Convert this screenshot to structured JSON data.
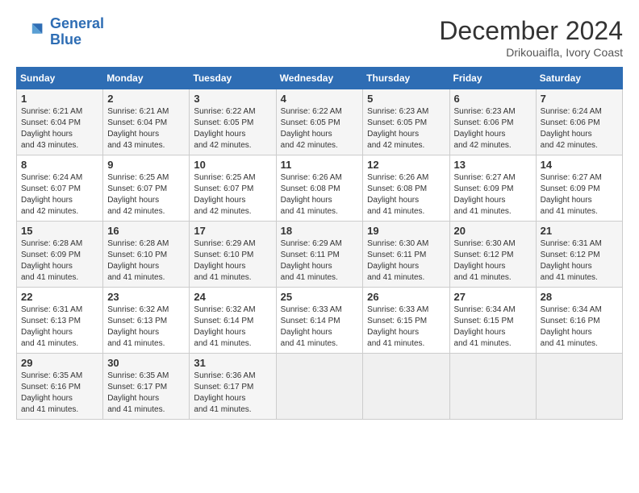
{
  "header": {
    "logo_line1": "General",
    "logo_line2": "Blue",
    "month_year": "December 2024",
    "location": "Drikouaifla, Ivory Coast"
  },
  "days_of_week": [
    "Sunday",
    "Monday",
    "Tuesday",
    "Wednesday",
    "Thursday",
    "Friday",
    "Saturday"
  ],
  "weeks": [
    [
      {
        "day": "1",
        "sunrise": "6:21 AM",
        "sunset": "6:04 PM",
        "daylight": "11 hours and 43 minutes."
      },
      {
        "day": "2",
        "sunrise": "6:21 AM",
        "sunset": "6:04 PM",
        "daylight": "11 hours and 43 minutes."
      },
      {
        "day": "3",
        "sunrise": "6:22 AM",
        "sunset": "6:05 PM",
        "daylight": "11 hours and 42 minutes."
      },
      {
        "day": "4",
        "sunrise": "6:22 AM",
        "sunset": "6:05 PM",
        "daylight": "11 hours and 42 minutes."
      },
      {
        "day": "5",
        "sunrise": "6:23 AM",
        "sunset": "6:05 PM",
        "daylight": "11 hours and 42 minutes."
      },
      {
        "day": "6",
        "sunrise": "6:23 AM",
        "sunset": "6:06 PM",
        "daylight": "11 hours and 42 minutes."
      },
      {
        "day": "7",
        "sunrise": "6:24 AM",
        "sunset": "6:06 PM",
        "daylight": "11 hours and 42 minutes."
      }
    ],
    [
      {
        "day": "8",
        "sunrise": "6:24 AM",
        "sunset": "6:07 PM",
        "daylight": "11 hours and 42 minutes."
      },
      {
        "day": "9",
        "sunrise": "6:25 AM",
        "sunset": "6:07 PM",
        "daylight": "11 hours and 42 minutes."
      },
      {
        "day": "10",
        "sunrise": "6:25 AM",
        "sunset": "6:07 PM",
        "daylight": "11 hours and 42 minutes."
      },
      {
        "day": "11",
        "sunrise": "6:26 AM",
        "sunset": "6:08 PM",
        "daylight": "11 hours and 41 minutes."
      },
      {
        "day": "12",
        "sunrise": "6:26 AM",
        "sunset": "6:08 PM",
        "daylight": "11 hours and 41 minutes."
      },
      {
        "day": "13",
        "sunrise": "6:27 AM",
        "sunset": "6:09 PM",
        "daylight": "11 hours and 41 minutes."
      },
      {
        "day": "14",
        "sunrise": "6:27 AM",
        "sunset": "6:09 PM",
        "daylight": "11 hours and 41 minutes."
      }
    ],
    [
      {
        "day": "15",
        "sunrise": "6:28 AM",
        "sunset": "6:09 PM",
        "daylight": "11 hours and 41 minutes."
      },
      {
        "day": "16",
        "sunrise": "6:28 AM",
        "sunset": "6:10 PM",
        "daylight": "11 hours and 41 minutes."
      },
      {
        "day": "17",
        "sunrise": "6:29 AM",
        "sunset": "6:10 PM",
        "daylight": "11 hours and 41 minutes."
      },
      {
        "day": "18",
        "sunrise": "6:29 AM",
        "sunset": "6:11 PM",
        "daylight": "11 hours and 41 minutes."
      },
      {
        "day": "19",
        "sunrise": "6:30 AM",
        "sunset": "6:11 PM",
        "daylight": "11 hours and 41 minutes."
      },
      {
        "day": "20",
        "sunrise": "6:30 AM",
        "sunset": "6:12 PM",
        "daylight": "11 hours and 41 minutes."
      },
      {
        "day": "21",
        "sunrise": "6:31 AM",
        "sunset": "6:12 PM",
        "daylight": "11 hours and 41 minutes."
      }
    ],
    [
      {
        "day": "22",
        "sunrise": "6:31 AM",
        "sunset": "6:13 PM",
        "daylight": "11 hours and 41 minutes."
      },
      {
        "day": "23",
        "sunrise": "6:32 AM",
        "sunset": "6:13 PM",
        "daylight": "11 hours and 41 minutes."
      },
      {
        "day": "24",
        "sunrise": "6:32 AM",
        "sunset": "6:14 PM",
        "daylight": "11 hours and 41 minutes."
      },
      {
        "day": "25",
        "sunrise": "6:33 AM",
        "sunset": "6:14 PM",
        "daylight": "11 hours and 41 minutes."
      },
      {
        "day": "26",
        "sunrise": "6:33 AM",
        "sunset": "6:15 PM",
        "daylight": "11 hours and 41 minutes."
      },
      {
        "day": "27",
        "sunrise": "6:34 AM",
        "sunset": "6:15 PM",
        "daylight": "11 hours and 41 minutes."
      },
      {
        "day": "28",
        "sunrise": "6:34 AM",
        "sunset": "6:16 PM",
        "daylight": "11 hours and 41 minutes."
      }
    ],
    [
      {
        "day": "29",
        "sunrise": "6:35 AM",
        "sunset": "6:16 PM",
        "daylight": "11 hours and 41 minutes."
      },
      {
        "day": "30",
        "sunrise": "6:35 AM",
        "sunset": "6:17 PM",
        "daylight": "11 hours and 41 minutes."
      },
      {
        "day": "31",
        "sunrise": "6:36 AM",
        "sunset": "6:17 PM",
        "daylight": "11 hours and 41 minutes."
      },
      null,
      null,
      null,
      null
    ]
  ]
}
